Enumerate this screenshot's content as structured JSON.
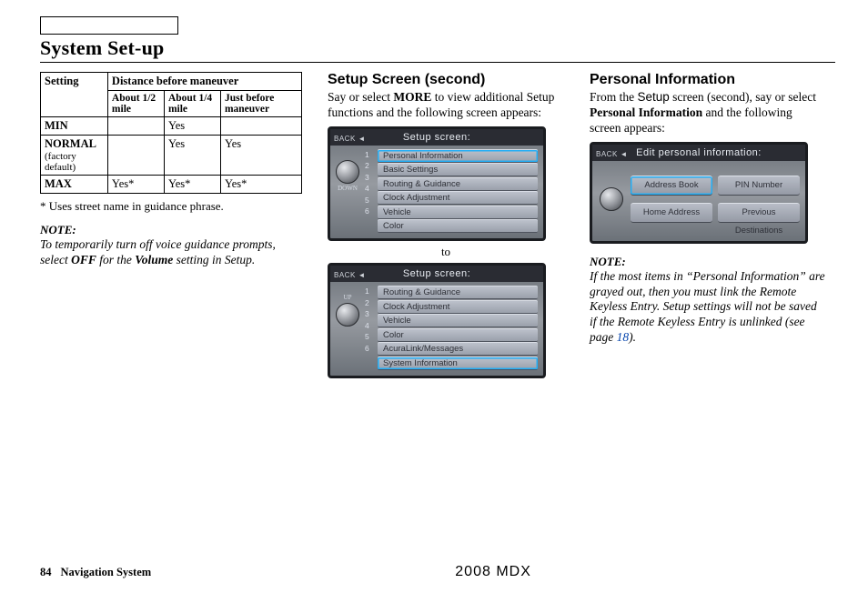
{
  "header": {
    "title": "System Set-up"
  },
  "left": {
    "table": {
      "col0": "Setting",
      "col1": "Distance before maneuver",
      "sub": [
        "About 1/2 mile",
        "About 1/4 mile",
        "Just before maneuver"
      ],
      "rows": [
        {
          "label": "MIN",
          "factory": "",
          "c1": "",
          "c2": "Yes",
          "c3": ""
        },
        {
          "label": "NORMAL",
          "factory": "(factory default)",
          "c1": "",
          "c2": "Yes",
          "c3": "Yes"
        },
        {
          "label": "MAX",
          "factory": "",
          "c1": "Yes*",
          "c2": "Yes*",
          "c3": "Yes*"
        }
      ]
    },
    "footnote": "*  Uses street name in guidance phrase.",
    "note_label": "NOTE:",
    "note_1a": "To temporarily turn off voice guidance prompts, select ",
    "note_off": "OFF",
    "note_1b": " for the ",
    "note_vol": "Volume",
    "note_1c": " setting in Setup."
  },
  "col2": {
    "heading": "Setup Screen (second)",
    "intro_a": "Say or select ",
    "intro_more": "MORE",
    "intro_b": " to view additional Setup functions and the following screen appears:",
    "screen_title": "Setup screen:",
    "back": "BACK ◄",
    "list1_nums": [
      "1",
      "2",
      "3",
      "4",
      "5",
      "6"
    ],
    "list1": [
      "Personal Information",
      "Basic Settings",
      "Routing & Guidance",
      "Clock Adjustment",
      "Vehicle",
      "Color"
    ],
    "up": "UP",
    "down": "DOWN",
    "to": "to",
    "list2_nums": [
      "1",
      "2",
      "3",
      "4",
      "5",
      "6"
    ],
    "list2": [
      "Routing & Guidance",
      "Clock Adjustment",
      "Vehicle",
      "Color",
      "AcuraLink/Messages",
      "System Information"
    ]
  },
  "col3": {
    "heading": "Personal Information",
    "intro_a": "From the ",
    "intro_setup": "Setup",
    "intro_b": " screen (second), say or select ",
    "intro_pi": "Personal Information",
    "intro_c": " and the following screen appears:",
    "screen_title": "Edit personal information:",
    "buttons": {
      "tl": "Address Book",
      "tr": "PIN Number",
      "bl": "Home Address",
      "br": "Previous Destinations"
    },
    "note_label": "NOTE:",
    "note_a": "If the most items in “Personal Information” are grayed out, then you must link the Remote Keyless Entry. Setup settings will not be saved if the Remote Keyless Entry is unlinked (see page ",
    "note_link": "18",
    "note_b": ")."
  },
  "footer": {
    "page": "84",
    "label": "Navigation System",
    "model": "2008 MDX"
  }
}
